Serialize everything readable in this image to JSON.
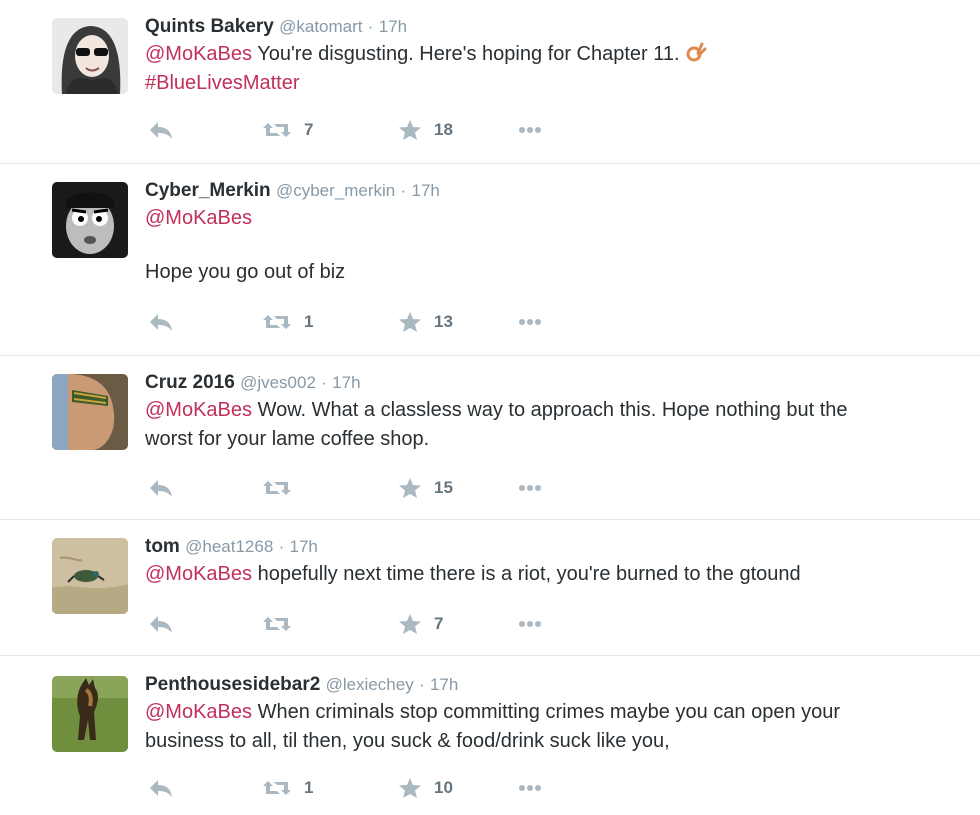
{
  "tweets": [
    {
      "name": "Quints Bakery",
      "handle": "@katomart",
      "time": "17h",
      "mention": "@MoKaBes",
      "text": "You're disgusting. Here's hoping for Chapter 11.",
      "hashtag": "#BlueLivesMatter",
      "retweets": "7",
      "favorites": "18",
      "avatar": "woman-sunglasses-icon"
    },
    {
      "name": "Cyber_Merkin",
      "handle": "@cyber_merkin",
      "time": "17h",
      "mention": "@MoKaBes",
      "text": "Hope you go out of biz",
      "retweets": "1",
      "favorites": "13",
      "avatar": "face-bw-icon"
    },
    {
      "name": "Cruz 2016",
      "handle": "@jves002",
      "time": "17h",
      "mention": "@MoKaBes",
      "text": "Wow.  What a classless way to approach this.  Hope nothing but the",
      "text2": "worst for your lame coffee shop.",
      "retweets": "",
      "favorites": "15",
      "avatar": "tattoo-arm-icon"
    },
    {
      "name": "tom",
      "handle": "@heat1268",
      "time": "17h",
      "mention": "@MoKaBes",
      "text": "hopefully next time there is a riot, you're burned to the gtound",
      "retweets": "",
      "favorites": "7",
      "avatar": "sand-bird-icon"
    },
    {
      "name": "Penthousesidebar2",
      "handle": "@lexiechey",
      "time": "17h",
      "mention": "@MoKaBes",
      "text": "When criminals stop committing crimes maybe you can open your",
      "text2": "business to all, til then, you suck & food/drink suck like you,",
      "retweets": "1",
      "favorites": "10",
      "avatar": "german-shepherd-icon"
    }
  ],
  "separator": "·",
  "colors": {
    "mention": "#c0305a",
    "muted": "#8899a6",
    "icon": "#aab8c2"
  }
}
